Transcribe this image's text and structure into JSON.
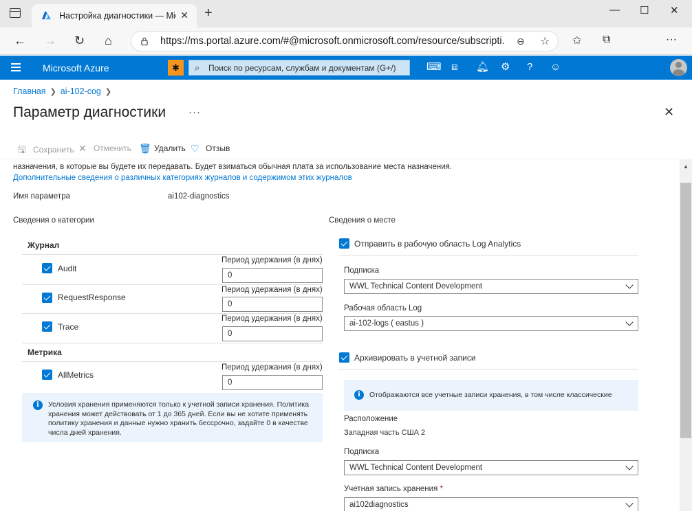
{
  "browser": {
    "tab_title": "Настройка диагностики — Mic",
    "tab_close": "✕",
    "new_tab": "+",
    "url": "https://ms.portal.azure.com/#@microsoft.onmicrosoft.com/resource/subscripti...",
    "window_controls": {
      "minimize": "—",
      "maximize": "☐",
      "close": "✕"
    },
    "icons": [
      "tab-actions-icon",
      "back-icon",
      "forward-icon",
      "refresh-icon",
      "home-icon",
      "lock-icon",
      "zoom-icon",
      "add-favorite-icon",
      "favorites-icon",
      "collections-icon",
      "more-icon"
    ]
  },
  "azure": {
    "brand": "Microsoft Azure",
    "search_placeholder": "Поиск по ресурсам, службам и документам (G+/)",
    "header_icons": [
      "cloud-shell-icon",
      "directory-filter-icon",
      "notifications-icon",
      "settings-icon",
      "help-icon",
      "feedback-icon",
      "avatar"
    ]
  },
  "breadcrumb": [
    "Главная",
    "ai-102-cog"
  ],
  "page": {
    "title": "Параметр диагностики",
    "more": "···",
    "close": "✕"
  },
  "commands": {
    "save": "Сохранить",
    "discard": "Отменить",
    "delete": "Удалить",
    "feedback": "Отзыв"
  },
  "description": {
    "text": "назначения, в которые вы будете их передавать. Будет взиматься обычная плата за использование места назначения.",
    "link": "Дополнительные сведения о различных категориях журналов и содержимом этих журналов"
  },
  "setting": {
    "name_label": "Имя параметра",
    "name_value": "ai102-diagnostics"
  },
  "category_section": {
    "title": "Сведения о категории",
    "log_group": "Журнал",
    "metric_group": "Метрика",
    "retention_label": "Период удержания (в днях)",
    "logs": [
      {
        "name": "Audit",
        "checked": true,
        "retention": "0"
      },
      {
        "name": "RequestResponse",
        "checked": true,
        "retention": "0"
      },
      {
        "name": "Trace",
        "checked": true,
        "retention": "0"
      }
    ],
    "metrics": [
      {
        "name": "AllMetrics",
        "checked": true,
        "retention": "0"
      }
    ],
    "info": "Условия хранения применяются только к учетной записи хранения. Политика хранения может действовать от 1 до 365 дней. Если вы не хотите применять политику хранения и данные нужно хранить бессрочно, задайте 0 в качестве числа дней хранения."
  },
  "destination_section": {
    "title": "Сведения о месте",
    "log_analytics": {
      "label": "Отправить в рабочую область Log Analytics",
      "checked": true,
      "subscription_label": "Подписка",
      "subscription_value": "WWL Technical Content Development",
      "workspace_label": "Рабочая область Log",
      "workspace_value": "ai-102-logs ( eastus )"
    },
    "archive": {
      "label": "Архивировать в учетной записи",
      "checked": true,
      "info": "Отображаются все учетные записи хранения, в том числе классические",
      "location_label": "Расположение",
      "location_value": "Западная часть США 2",
      "subscription_label": "Подписка",
      "subscription_value": "WWL Technical Content Development",
      "storage_label": "Учетная запись хранения",
      "required_mark": "*",
      "storage_value": "ai102diagnostics"
    }
  }
}
